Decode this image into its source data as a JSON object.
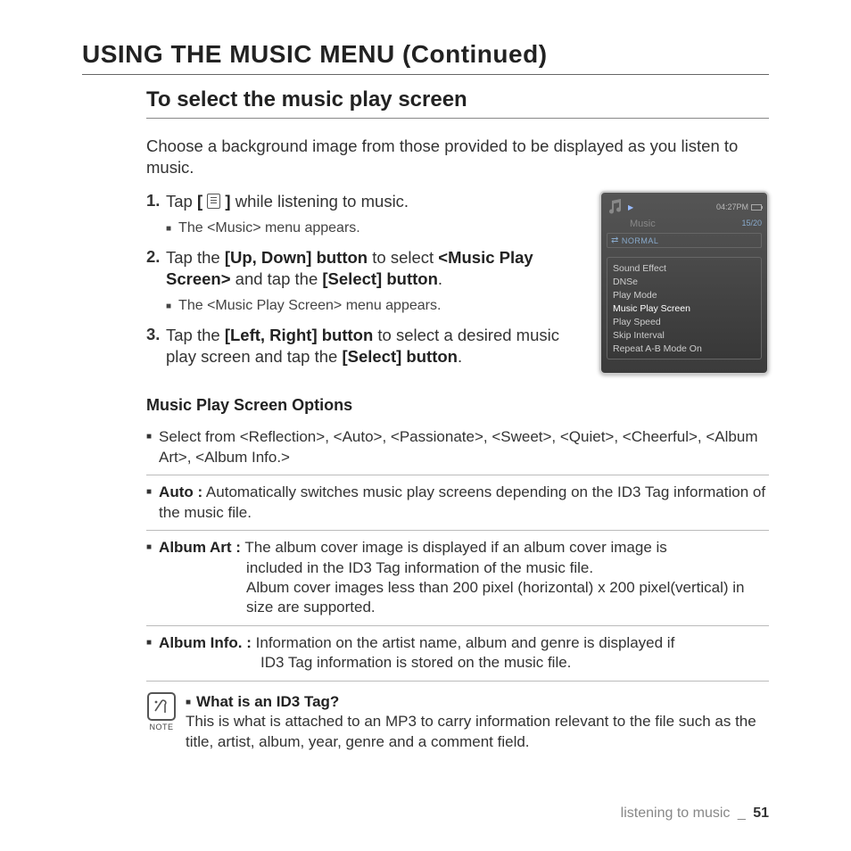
{
  "page_title": "USING THE MUSIC MENU (Continued)",
  "section_title": "To select the music play screen",
  "intro": "Choose a background image from those provided to be displayed as you listen to music.",
  "steps": [
    {
      "num": "1.",
      "prefix": "Tap ",
      "bold_before_icon": "[ ",
      "bold_after_icon": " ]",
      "suffix": " while listening to music.",
      "sub": "The <Music> menu appears."
    },
    {
      "num": "2.",
      "html_parts": [
        "Tap the ",
        "[Up, Down] button",
        " to select ",
        "<Music Play Screen>",
        " and tap the ",
        "[Select] button",
        "."
      ],
      "sub": "The <Music Play Screen> menu appears."
    },
    {
      "num": "3.",
      "html_parts": [
        "Tap the ",
        "[Left, Right] button",
        " to select a desired music play screen and tap the ",
        "[Select] button",
        "."
      ]
    }
  ],
  "device": {
    "time": "04:27PM",
    "title": "Music",
    "count": "15/20",
    "mode": "NORMAL",
    "menu": [
      "Sound Effect",
      "DNSe",
      "Play Mode",
      "Music Play Screen",
      "Play Speed",
      "Skip Interval",
      "Repeat A-B Mode On"
    ],
    "active_index": 3
  },
  "subsection_title": "Music Play Screen Options",
  "options": [
    {
      "text": "Select from <Reflection>, <Auto>, <Passionate>, <Sweet>, <Quiet>, <Cheerful>, <Album Art>, <Album Info.>"
    },
    {
      "label": "Auto :",
      "text": " Automatically switches music play screens depending on the ID3 Tag information of the music file."
    },
    {
      "label": "Album Art :",
      "text": " The album cover image is displayed if an album cover image is",
      "cont": [
        "included in the ID3 Tag information of the music file.",
        "Album cover images less than 200 pixel (horizontal) x 200 pixel(vertical) in size are supported."
      ]
    },
    {
      "label": "Album Info. :",
      "text": " Information on the artist name, album and genre is displayed if",
      "cont": [
        "ID3 Tag information is stored on the music file."
      ]
    }
  ],
  "note": {
    "label": "NOTE",
    "title": "What is an ID3 Tag?",
    "body": "This is what is attached to an MP3 to carry information relevant to the file such as the title, artist, album, year, genre and a comment field."
  },
  "footer": {
    "section": "listening to music",
    "sep": "_",
    "page": "51"
  }
}
